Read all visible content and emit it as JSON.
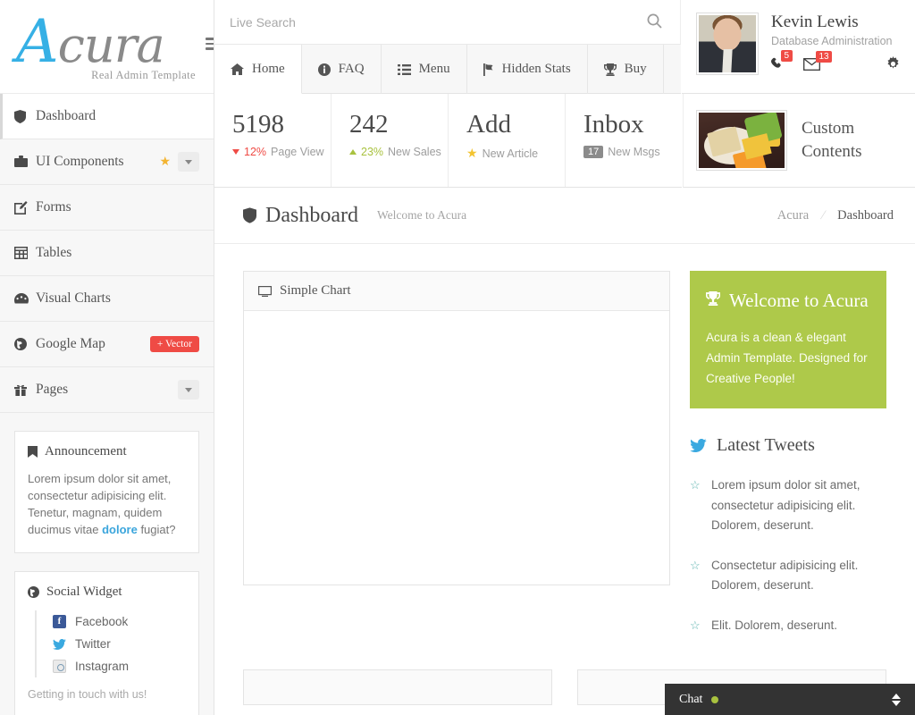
{
  "brand": {
    "name_first": "A",
    "name_rest": "cura",
    "tagline": "Real Admin Template"
  },
  "sidebar": {
    "items": [
      {
        "label": "Dashboard",
        "icon": "shield-icon",
        "active": true
      },
      {
        "label": "UI Components",
        "icon": "briefcase-icon",
        "star": true,
        "caret": true
      },
      {
        "label": "Forms",
        "icon": "pencil-square-icon"
      },
      {
        "label": "Tables",
        "icon": "table-icon"
      },
      {
        "label": "Visual Charts",
        "icon": "dashboard-icon"
      },
      {
        "label": "Google Map",
        "icon": "globe-icon",
        "badge": "+ Vector"
      },
      {
        "label": "Pages",
        "icon": "gift-icon",
        "caret": true
      }
    ],
    "announcement": {
      "title": "Announcement",
      "text_before": "Lorem ipsum dolor sit amet, consectetur adipisicing elit. Tenetur, magnam, quidem ducimus vitae ",
      "link": "dolore",
      "text_after": " fugiat?"
    },
    "social": {
      "title": "Social Widget",
      "links": [
        "Facebook",
        "Twitter",
        "Instagram"
      ],
      "footer": "Getting in touch with us!"
    }
  },
  "search": {
    "placeholder": "Live Search",
    "value": ""
  },
  "tabs": [
    {
      "label": "Home",
      "icon": "home-icon",
      "active": true
    },
    {
      "label": "FAQ",
      "icon": "info-circle-icon"
    },
    {
      "label": "Menu",
      "icon": "list-icon"
    },
    {
      "label": "Hidden Stats",
      "icon": "flag-icon"
    },
    {
      "label": "Buy",
      "icon": "trophy-icon"
    }
  ],
  "profile": {
    "name": "Kevin Lewis",
    "role": "Database Administration",
    "notifications": "5",
    "messages": "13"
  },
  "stats": [
    {
      "value": "5198",
      "delta": "12%",
      "delta_dir": "down",
      "label": "Page View"
    },
    {
      "value": "242",
      "delta": "23%",
      "delta_dir": "up",
      "label": "New Sales"
    },
    {
      "value": "Add",
      "badge_type": "star",
      "label": "New Article"
    },
    {
      "value": "Inbox",
      "badge": "17",
      "label": "New Msgs"
    }
  ],
  "custom_contents": {
    "title": "Custom Contents"
  },
  "page": {
    "title": "Dashboard",
    "subtitle": "Welcome to Acura",
    "breadcrumb_root": "Acura",
    "breadcrumb_current": "Dashboard"
  },
  "chart_panel": {
    "title": "Simple Chart"
  },
  "welcome": {
    "title": "Welcome to Acura",
    "text": "Acura is a clean & elegant Admin Template. Designed for Creative People!"
  },
  "tweets": {
    "title": "Latest Tweets",
    "items": [
      "Lorem ipsum dolor sit amet, consectetur adipisicing elit. Dolorem, deserunt.",
      "Consectetur adipisicing elit. Dolorem, deserunt.",
      "Elit. Dolorem, deserunt."
    ]
  },
  "chat": {
    "label": "Chat",
    "status_color": "#a9c23f"
  },
  "colors": {
    "accent_blue": "#36b0e5",
    "green": "#aec94a",
    "red": "#ef4b45",
    "star_yellow": "#f3b431"
  }
}
